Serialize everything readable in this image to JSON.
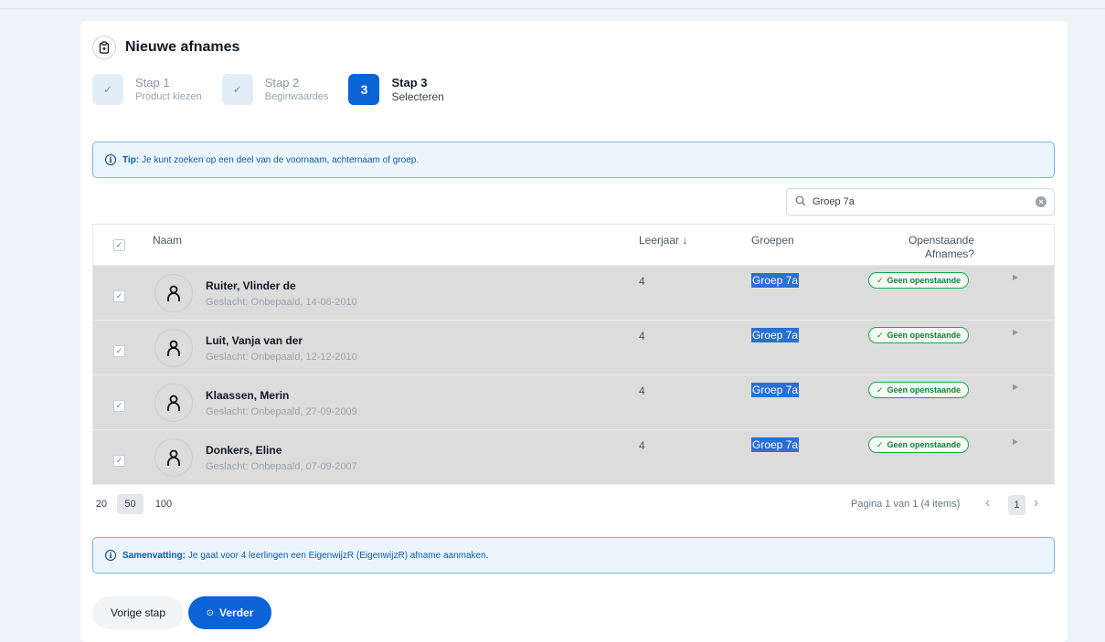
{
  "header": {
    "title": "Nieuwe afnames",
    "icon": "clipboard-icon"
  },
  "steps": [
    {
      "title": "Stap 1",
      "sub": "Product kiezen",
      "marker": "✓",
      "state": "done"
    },
    {
      "title": "Stap 2",
      "sub": "Beginwaardes",
      "marker": "✓",
      "state": "done"
    },
    {
      "title": "Stap 3",
      "sub": "Selecteren",
      "marker": "3",
      "state": "current"
    }
  ],
  "tip": {
    "label": "Tip:",
    "text": "Je kunt zoeken op een deel van de voornaam, achternaam of groep."
  },
  "search": {
    "value": "Groep 7a"
  },
  "table": {
    "headers": {
      "name": "Naam",
      "year": "Leerjaar",
      "year_sort": "↓",
      "groups": "Groepen",
      "open_line1": "Openstaande",
      "open_line2": "Afnames?"
    },
    "rows": [
      {
        "name": "Ruiter, Vlinder de",
        "sub": "Geslacht: Onbepaald, 14-06-2010",
        "year": "4",
        "group": "Groep 7a",
        "status": "Geen openstaande"
      },
      {
        "name": "Luit, Vanja van der",
        "sub": "Geslacht: Onbepaald, 12-12-2010",
        "year": "4",
        "group": "Groep 7a",
        "status": "Geen openstaande"
      },
      {
        "name": "Klaassen, Merin",
        "sub": "Geslacht: Onbepaald, 27-09-2009",
        "year": "4",
        "group": "Groep 7a",
        "status": "Geen openstaande"
      },
      {
        "name": "Donkers, Eline",
        "sub": "Geslacht: Onbepaald, 07-09-2007",
        "year": "4",
        "group": "Groep 7a",
        "status": "Geen openstaande"
      }
    ]
  },
  "pagination": {
    "sizes": [
      "20",
      "50",
      "100"
    ],
    "selected_size": "50",
    "info": "Pagina 1 van 1 (4 items)",
    "current_page": "1"
  },
  "summary": {
    "label": "Samenvatting:",
    "text": "Je gaat voor 4 leerlingen een EigenwijzR (EigenwijzR) afname aanmaken."
  },
  "buttons": {
    "prev": "Vorige stap",
    "next": "Verder"
  },
  "colors": {
    "primary": "#0b63d6",
    "success": "#22a34a",
    "info_border": "#7fb0df"
  }
}
